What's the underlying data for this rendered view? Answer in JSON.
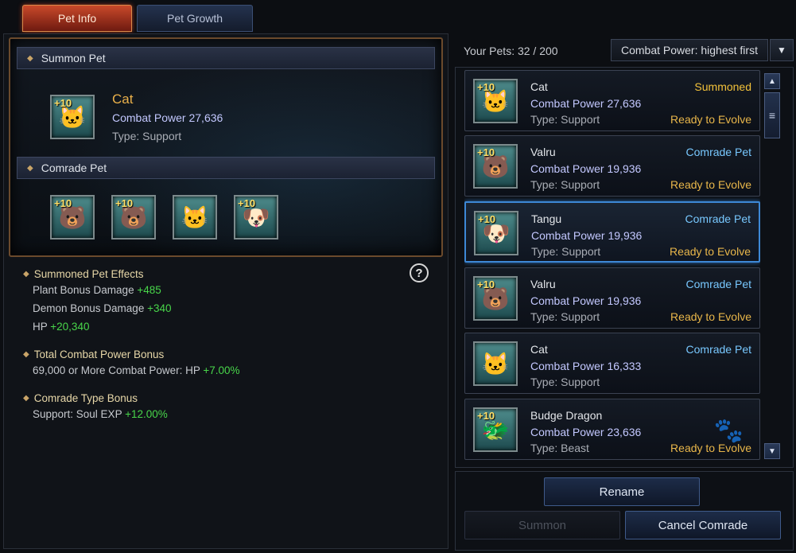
{
  "tabs": [
    {
      "label": "Pet Info"
    },
    {
      "label": "Pet Growth"
    }
  ],
  "summon_section": {
    "header": "Summon Pet",
    "pet": {
      "level": "+10",
      "name": "Cat",
      "combat_power": "Combat Power 27,636",
      "type": "Type: Support"
    }
  },
  "comrade_section": {
    "header": "Comrade Pet",
    "pets": [
      {
        "level": "+10",
        "icon": "valru-icon"
      },
      {
        "level": "+10",
        "icon": "valru-icon"
      },
      {
        "level": "",
        "icon": "cat-icon"
      },
      {
        "level": "+10",
        "icon": "tangu-icon"
      }
    ]
  },
  "effects": [
    {
      "title": "Summoned Pet Effects",
      "lines": [
        {
          "label": "Plant Bonus Damage",
          "value": "+485"
        },
        {
          "label": "Demon Bonus Damage",
          "value": "+340"
        },
        {
          "label": "HP",
          "value": "+20,340"
        }
      ]
    },
    {
      "title": "Total Combat Power Bonus",
      "lines": [
        {
          "label": "69,000 or More Combat Power: HP",
          "value": "+7.00%"
        }
      ]
    },
    {
      "title": "Comrade Type Bonus",
      "lines": [
        {
          "label": "Support: Soul EXP",
          "value": "+12.00%"
        }
      ]
    }
  ],
  "help_label": "?",
  "pet_list": {
    "count_label": "Your Pets: 32 / 200",
    "sort_value": "Combat Power: highest first",
    "items": [
      {
        "level": "+10",
        "name": "Cat",
        "combat_power": "Combat Power 27,636",
        "type": "Type: Support",
        "status": "Summoned",
        "evolve": "Ready to Evolve"
      },
      {
        "level": "+10",
        "name": "Valru",
        "combat_power": "Combat Power 19,936",
        "type": "Type: Support",
        "status": "Comrade Pet",
        "evolve": "Ready to Evolve"
      },
      {
        "level": "+10",
        "name": "Tangu",
        "combat_power": "Combat Power 19,936",
        "type": "Type: Support",
        "status": "Comrade Pet",
        "evolve": "Ready to Evolve"
      },
      {
        "level": "+10",
        "name": "Valru",
        "combat_power": "Combat Power 19,936",
        "type": "Type: Support",
        "status": "Comrade Pet",
        "evolve": "Ready to Evolve"
      },
      {
        "level": "",
        "name": "Cat",
        "combat_power": "Combat Power 16,333",
        "type": "Type: Support",
        "status": "Comrade Pet",
        "evolve": ""
      },
      {
        "level": "+10",
        "name": "Budge Dragon",
        "combat_power": "Combat Power 23,636",
        "type": "Type: Beast",
        "status": "",
        "evolve": "Ready to Evolve"
      }
    ]
  },
  "buttons": {
    "rename": "Rename",
    "summon": "Summon",
    "cancel_comrade": "Cancel Comrade"
  }
}
